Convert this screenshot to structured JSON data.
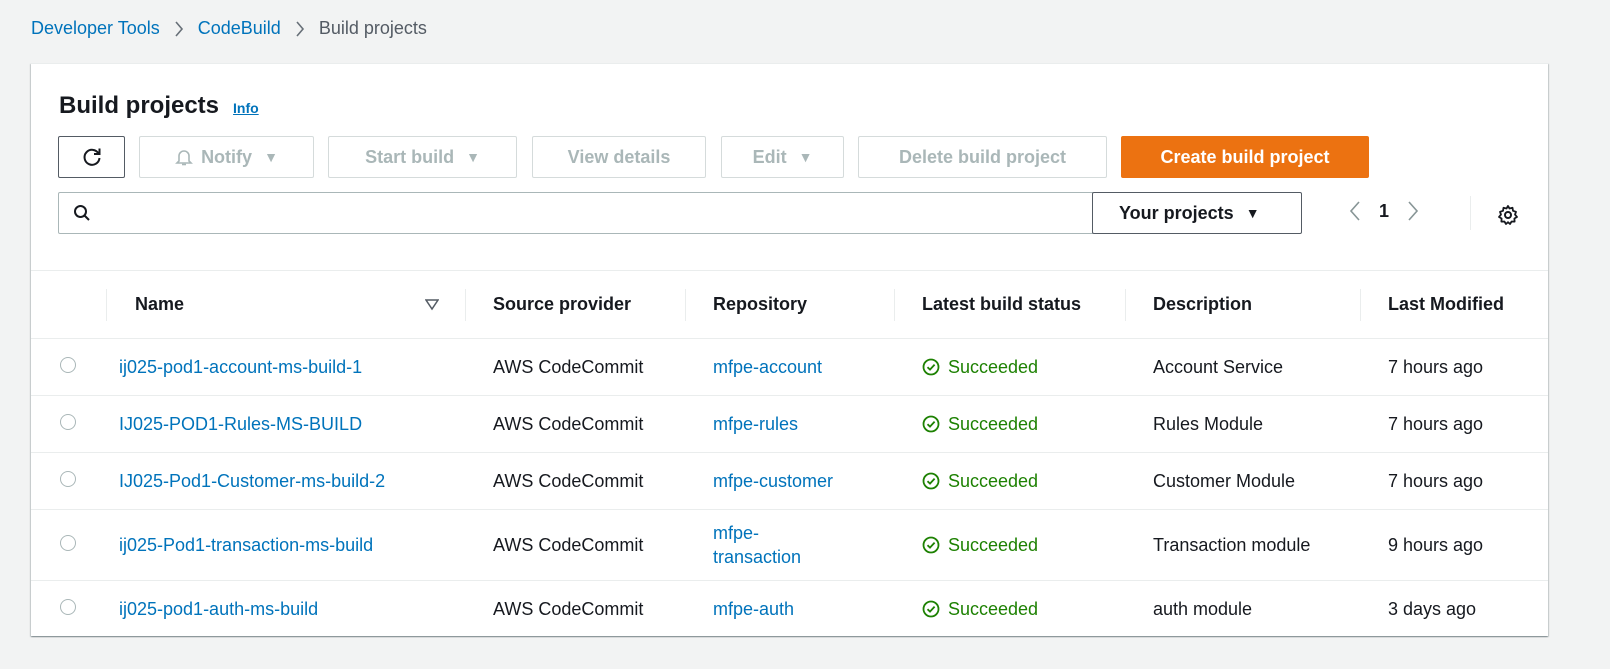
{
  "breadcrumb": {
    "items": [
      "Developer Tools",
      "CodeBuild"
    ],
    "current": "Build projects"
  },
  "header": {
    "title": "Build projects",
    "info": "Info"
  },
  "toolbar": {
    "notify": "Notify",
    "start_build": "Start build",
    "view_details": "View details",
    "edit": "Edit",
    "delete": "Delete build project",
    "create": "Create build project"
  },
  "search": {
    "value": "",
    "placeholder": ""
  },
  "filter": {
    "label": "Your projects"
  },
  "pagination": {
    "page": "1"
  },
  "table": {
    "columns": [
      "Name",
      "Source provider",
      "Repository",
      "Latest build status",
      "Description",
      "Last Modified"
    ],
    "rows": [
      {
        "name": "ij025-pod1-account-ms-build-1",
        "source": "AWS CodeCommit",
        "repo": "mfpe-account",
        "status": "Succeeded",
        "description": "Account Service",
        "modified": "7 hours ago"
      },
      {
        "name": "IJ025-POD1-Rules-MS-BUILD",
        "source": "AWS CodeCommit",
        "repo": "mfpe-rules",
        "status": "Succeeded",
        "description": "Rules Module",
        "modified": "7 hours ago"
      },
      {
        "name": "IJ025-Pod1-Customer-ms-build-2",
        "source": "AWS CodeCommit",
        "repo": "mfpe-customer",
        "status": "Succeeded",
        "description": "Customer Module",
        "modified": "7 hours ago"
      },
      {
        "name": "ij025-Pod1-transaction-ms-build",
        "source": "AWS CodeCommit",
        "repo_line1": "mfpe-",
        "repo_line2": "transaction",
        "status": "Succeeded",
        "description": "Transaction module",
        "modified": "9 hours ago"
      },
      {
        "name": "ij025-pod1-auth-ms-build",
        "source": "AWS CodeCommit",
        "repo": "mfpe-auth",
        "status": "Succeeded",
        "description": "auth module",
        "modified": "3 days ago"
      }
    ]
  },
  "colors": {
    "link": "#0073bb",
    "primary": "#ec7211",
    "success": "#1d8102",
    "disabled": "#aab7b8"
  },
  "icons": {
    "refresh": "refresh-icon",
    "notify": "bell-icon",
    "search": "search-icon",
    "settings": "gear-icon",
    "sort": "sort-down-icon",
    "status": "check-circle-icon"
  }
}
